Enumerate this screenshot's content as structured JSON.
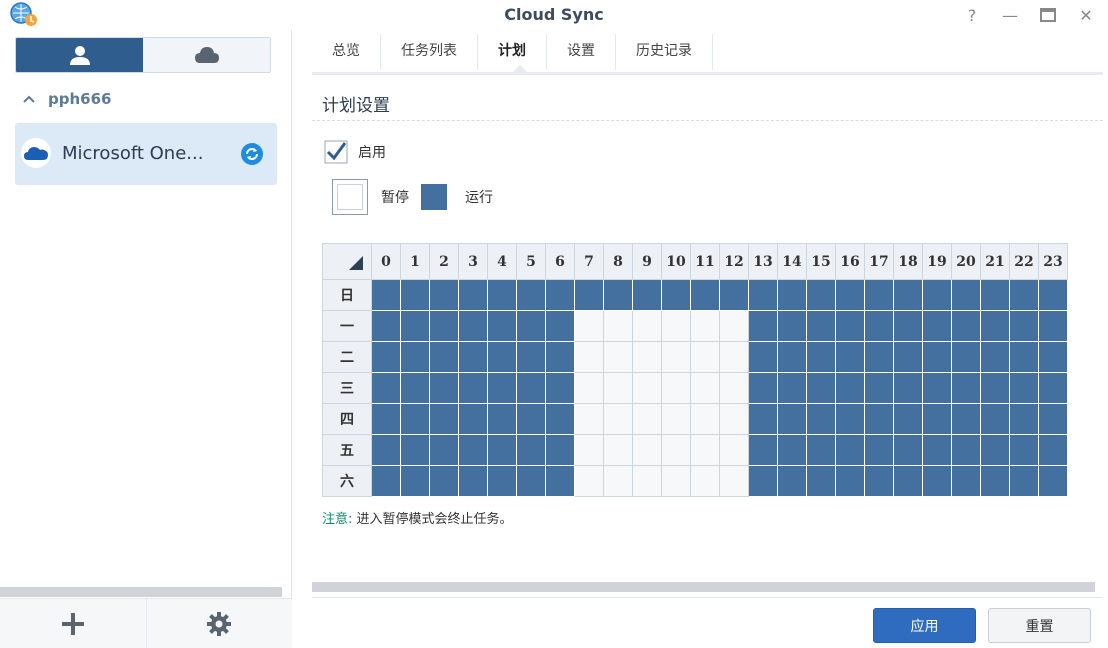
{
  "window": {
    "title": "Cloud Sync",
    "app_icon": "cloud-sync-icon",
    "controls": [
      "help-icon",
      "minimize-icon",
      "maximize-icon",
      "close-icon"
    ],
    "help_glyph": "?",
    "minimize_glyph": "—",
    "close_glyph": "✕"
  },
  "sidebar": {
    "segments": [
      {
        "icon": "user-icon",
        "active": true
      },
      {
        "icon": "cloud-icon",
        "active": false
      }
    ],
    "account": {
      "name": "pph666",
      "expanded": true
    },
    "tasks": [
      {
        "label": "Microsoft One...",
        "provider_icon": "onedrive-icon",
        "status_icon": "sync-icon"
      }
    ],
    "footer": [
      {
        "icon": "add-icon"
      },
      {
        "icon": "gear-icon"
      }
    ]
  },
  "tabs": [
    {
      "label": "总览",
      "active": false
    },
    {
      "label": "任务列表",
      "active": false
    },
    {
      "label": "计划",
      "active": true
    },
    {
      "label": "设置",
      "active": false
    },
    {
      "label": "历史记录",
      "active": false
    }
  ],
  "schedule": {
    "section_title": "计划设置",
    "enable_label": "启用",
    "enabled": true,
    "legend": {
      "pause_label": "暂停",
      "run_label": "运行"
    },
    "hours": [
      "0",
      "1",
      "2",
      "3",
      "4",
      "5",
      "6",
      "7",
      "8",
      "9",
      "10",
      "11",
      "12",
      "13",
      "14",
      "15",
      "16",
      "17",
      "18",
      "19",
      "20",
      "21",
      "22",
      "23"
    ],
    "days": [
      "日",
      "一",
      "二",
      "三",
      "四",
      "五",
      "六"
    ],
    "grid": [
      [
        1,
        1,
        1,
        1,
        1,
        1,
        1,
        1,
        1,
        1,
        1,
        1,
        1,
        1,
        1,
        1,
        1,
        1,
        1,
        1,
        1,
        1,
        1,
        1
      ],
      [
        1,
        1,
        1,
        1,
        1,
        1,
        1,
        0,
        0,
        0,
        0,
        0,
        0,
        1,
        1,
        1,
        1,
        1,
        1,
        1,
        1,
        1,
        1,
        1
      ],
      [
        1,
        1,
        1,
        1,
        1,
        1,
        1,
        0,
        0,
        0,
        0,
        0,
        0,
        1,
        1,
        1,
        1,
        1,
        1,
        1,
        1,
        1,
        1,
        1
      ],
      [
        1,
        1,
        1,
        1,
        1,
        1,
        1,
        0,
        0,
        0,
        0,
        0,
        0,
        1,
        1,
        1,
        1,
        1,
        1,
        1,
        1,
        1,
        1,
        1
      ],
      [
        1,
        1,
        1,
        1,
        1,
        1,
        1,
        0,
        0,
        0,
        0,
        0,
        0,
        1,
        1,
        1,
        1,
        1,
        1,
        1,
        1,
        1,
        1,
        1
      ],
      [
        1,
        1,
        1,
        1,
        1,
        1,
        1,
        0,
        0,
        0,
        0,
        0,
        0,
        1,
        1,
        1,
        1,
        1,
        1,
        1,
        1,
        1,
        1,
        1
      ],
      [
        1,
        1,
        1,
        1,
        1,
        1,
        1,
        0,
        0,
        0,
        0,
        0,
        0,
        1,
        1,
        1,
        1,
        1,
        1,
        1,
        1,
        1,
        1,
        1
      ]
    ],
    "note_key": "注意:",
    "note_text": " 进入暂停模式会终止任务。"
  },
  "buttons": {
    "apply": "应用",
    "reset": "重置"
  },
  "colors": {
    "run": "#44709f",
    "accent": "#2f6cbf",
    "note": "#0e8a6c"
  }
}
